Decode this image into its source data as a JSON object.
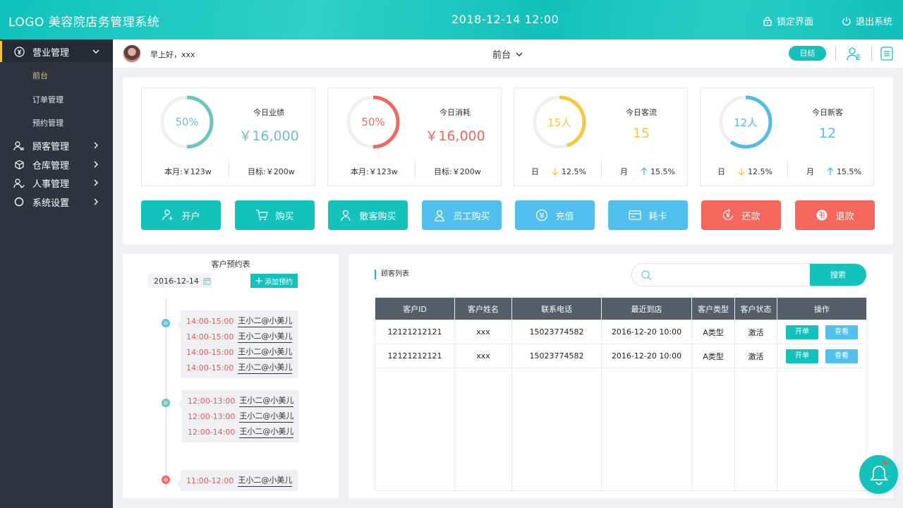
{
  "header": {
    "title": "LOGO 美容院店务管理系统",
    "datetime": "2018-12-14  12:00",
    "lock_label": "锁定界面",
    "logout_label": "退出系统"
  },
  "sidebar": {
    "sections": [
      {
        "label": "营业管理",
        "icon": "yen-circle-icon"
      },
      {
        "label": "顾客管理",
        "icon": "users-icon"
      },
      {
        "label": "仓库管理",
        "icon": "box-icon"
      },
      {
        "label": "人事管理",
        "icon": "person-icon"
      },
      {
        "label": "系统设置",
        "icon": "settings-circle-icon"
      }
    ],
    "sub_items": [
      "前台",
      "订单管理",
      "预约管理"
    ],
    "active_sub": "前台"
  },
  "topbar": {
    "greeting": "早上好，xxx",
    "role_select": "前台",
    "daily_close": "日结"
  },
  "stats": [
    {
      "ring_label": "50%",
      "title": "今日业绩",
      "value": "￥16,000",
      "color": "#6cc5c3",
      "progress": 0.5,
      "foot_left": "本月:￥123w",
      "foot_right": "目标:￥200w"
    },
    {
      "ring_label": "50%",
      "title": "今日消耗",
      "value": "￥16,000",
      "color": "#f4675d",
      "progress": 0.5,
      "foot_left": "本月:￥123w",
      "foot_right": "目标:￥200w"
    },
    {
      "ring_label": "15人",
      "title": "今日客流",
      "value": "15",
      "color": "#f5c93a",
      "progress": 0.45,
      "foot_left_label": "日",
      "foot_left_value": "12.5%",
      "foot_left_trend": "down",
      "foot_right_label": "月",
      "foot_right_value": "15.5%",
      "foot_right_trend": "up"
    },
    {
      "ring_label": "12人",
      "title": "今日新客",
      "value": "12",
      "color": "#50bde8",
      "progress": 0.6,
      "foot_left_label": "日",
      "foot_left_value": "12.5%",
      "foot_left_trend": "down",
      "foot_right_label": "月",
      "foot_right_value": "15.5%",
      "foot_right_trend": "up"
    }
  ],
  "actions": [
    {
      "label": "开户",
      "color": "#14c2bc",
      "icon": "add-user-icon"
    },
    {
      "label": "购买",
      "color": "#14c2bc",
      "icon": "cart-icon"
    },
    {
      "label": "散客购买",
      "color": "#14c2bc",
      "icon": "walk-in-icon"
    },
    {
      "label": "员工购买",
      "color": "#52c0ee",
      "icon": "staff-icon"
    },
    {
      "label": "充值",
      "color": "#52c0ee",
      "icon": "recharge-icon"
    },
    {
      "label": "耗卡",
      "color": "#52c0ee",
      "icon": "card-icon"
    },
    {
      "label": "还款",
      "color": "#f4675d",
      "icon": "repay-icon"
    },
    {
      "label": "退款",
      "color": "#f4675d",
      "icon": "refund-icon"
    }
  ],
  "appointments": {
    "title": "客户预约表",
    "date": "2016-12-14",
    "add_label": "添加预约",
    "groups": [
      {
        "dot_color": "#5bc4da",
        "rows": [
          {
            "time": "14:00-15:00",
            "name": "王小二@小美儿"
          },
          {
            "time": "14:00-15:00",
            "name": "王小二@小美儿"
          },
          {
            "time": "14:00-15:00",
            "name": "王小二@小美儿"
          },
          {
            "time": "14:00-15:00",
            "name": "王小二@小美儿"
          }
        ]
      },
      {
        "dot_color": "#6cc5c3",
        "rows": [
          {
            "time": "12:00-13:00",
            "name": "王小二@小美儿"
          },
          {
            "time": "12:00-13:00",
            "name": "王小二@小美儿"
          },
          {
            "time": "12:00-14:00",
            "name": "王小二@小美儿"
          }
        ]
      },
      {
        "dot_color": "#f4675d",
        "rows": [
          {
            "time": "11:00-12:00",
            "name": "王小二@小美儿"
          }
        ]
      }
    ]
  },
  "customers": {
    "title": "顾客列表",
    "search_placeholder": "",
    "search_button": "搜索",
    "columns": [
      "客户ID",
      "客户姓名",
      "联系电话",
      "最近到店",
      "客户类型",
      "客户状态",
      "操作"
    ],
    "rows": [
      {
        "id": "12121212121",
        "name": "xxx",
        "phone": "15023774582",
        "last_visit": "2016-12-20  10:00",
        "type": "A类型",
        "status": "激活"
      },
      {
        "id": "12121212121",
        "name": "xxx",
        "phone": "15023774582",
        "last_visit": "2016-12-20  10:00",
        "type": "A类型",
        "status": "激活"
      }
    ],
    "op_open": "开单",
    "op_view": "查看",
    "op_open_color": "#14c2bc",
    "op_view_color": "#52c0ee"
  }
}
